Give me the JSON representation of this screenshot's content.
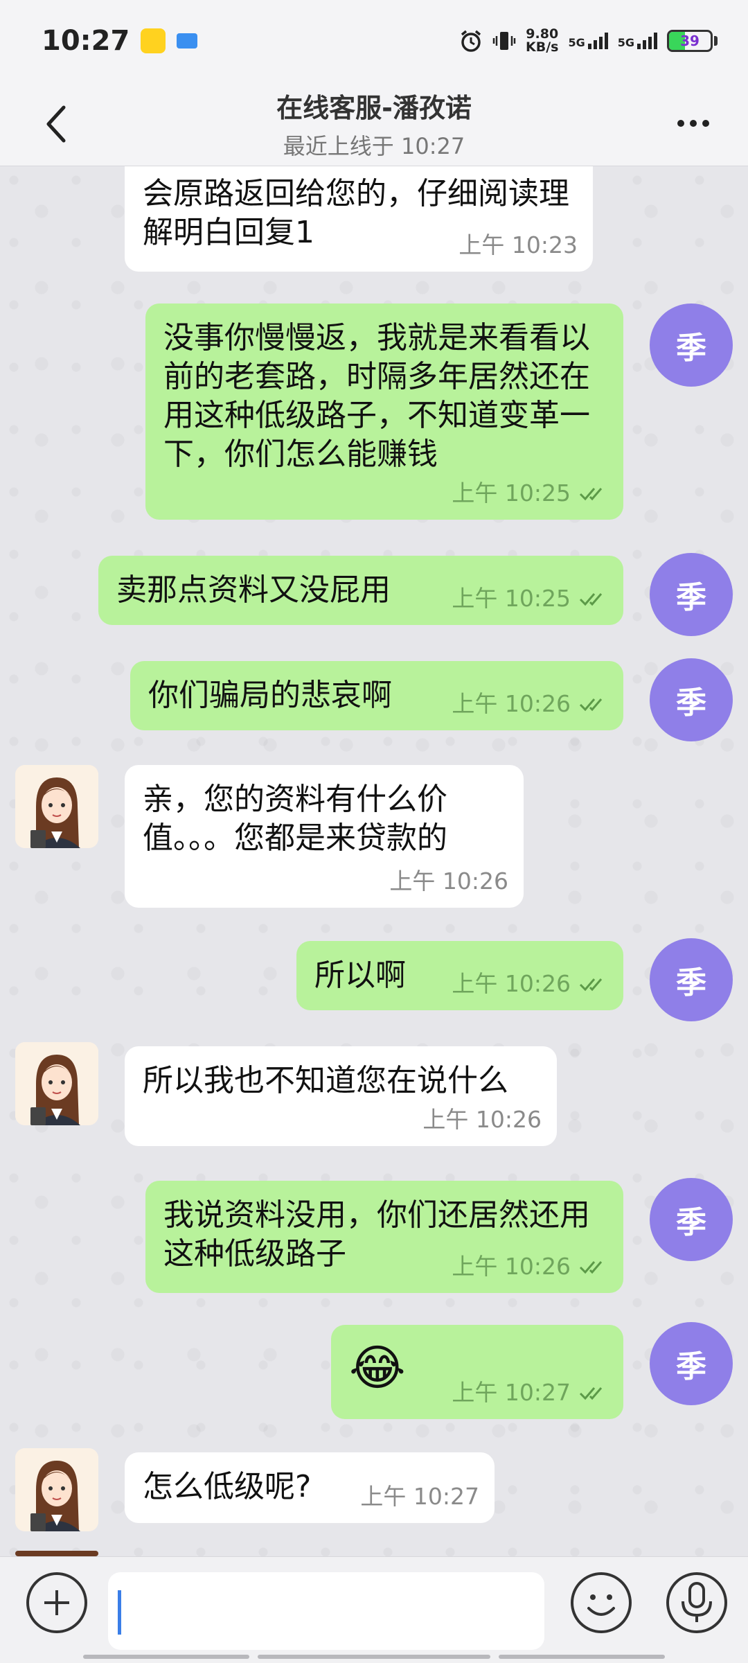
{
  "status_bar": {
    "time": "10:27",
    "speed_value": "9.80",
    "speed_unit": "KB/s",
    "network_1": "5G",
    "network_2": "5G",
    "battery": "39"
  },
  "header": {
    "title": "在线客服-潘孜诺",
    "subtitle": "最近上线于 10:27"
  },
  "messages": [
    {
      "side": "in",
      "text": "会原路返回给您的，仔细阅读理解明白回复1",
      "time": "上午 10:23"
    },
    {
      "side": "out",
      "avatar": "季",
      "text": "没事你慢慢返，我就是来看看以前的老套路，时隔多年居然还在用这种低级路子，不知道变革一下，你们怎么能赚钱",
      "time": "上午 10:25"
    },
    {
      "side": "out",
      "avatar": "季",
      "text": "卖那点资料又没屁用",
      "time": "上午 10:25"
    },
    {
      "side": "out",
      "avatar": "季",
      "text": "你们骗局的悲哀啊",
      "time": "上午 10:26"
    },
    {
      "side": "in",
      "text": "亲，您的资料有什么价值。。。您都是来贷款的",
      "time": "上午 10:26"
    },
    {
      "side": "out",
      "avatar": "季",
      "text": "所以啊",
      "time": "上午 10:26"
    },
    {
      "side": "in",
      "text": "所以我也不知道您在说什么",
      "time": "上午 10:26"
    },
    {
      "side": "out",
      "avatar": "季",
      "text": "我说资料没用，你们还居然还用这种低级路子",
      "time": "上午 10:26"
    },
    {
      "side": "out",
      "avatar": "季",
      "text": "😂",
      "time": "上午 10:27"
    },
    {
      "side": "in",
      "text": "怎么低级呢?",
      "time": "上午 10:27"
    }
  ],
  "input": {
    "value": ""
  },
  "colors": {
    "outgoing_bubble": "#b8f29b",
    "incoming_bubble": "#ffffff",
    "my_avatar": "#8f7fe8"
  },
  "icons": [
    "back-arrow-icon",
    "more-dots-icon",
    "plus-icon",
    "emoji-icon",
    "microphone-icon",
    "read-ticks-icon"
  ]
}
